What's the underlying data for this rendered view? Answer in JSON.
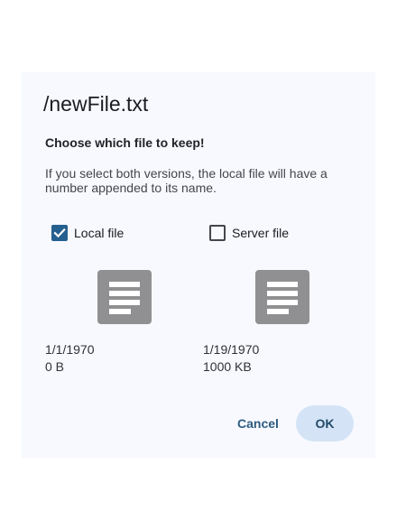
{
  "dialog": {
    "title": "/newFile.txt",
    "subtitle": "Choose which file to keep!",
    "description": "If you select both versions, the local file will have a number appended to its name.",
    "local": {
      "label": "Local file",
      "checked": true,
      "date": "1/1/1970",
      "size": "0 B",
      "icon": "document-icon"
    },
    "server": {
      "label": "Server file",
      "checked": false,
      "date": "1/19/1970",
      "size": "1000 KB",
      "icon": "document-icon"
    },
    "buttons": {
      "cancel": "Cancel",
      "ok": "OK"
    },
    "colors": {
      "accent": "#255f8f",
      "surface": "#f7f9fe",
      "ok_button_bg": "#d4e4f6",
      "icon_gray": "#909092"
    }
  }
}
